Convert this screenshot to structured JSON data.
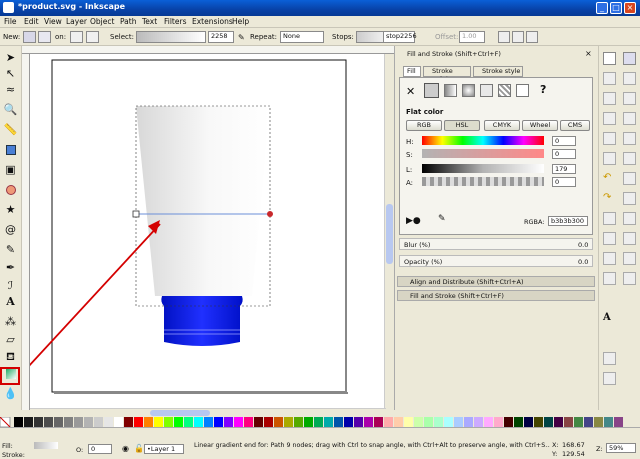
{
  "window": {
    "title": "*product.svg - Inkscape",
    "btn_min": "_",
    "btn_max": "□",
    "btn_close": "×"
  },
  "menu": [
    "File",
    "Edit",
    "View",
    "Layer",
    "Object",
    "Path",
    "Text",
    "Filters",
    "Extensions",
    "Help"
  ],
  "ctrl": {
    "new_label": "New:",
    "on_label": "on:",
    "select_label": "Select:",
    "select_value": "2258",
    "repeat_label": "Repeat:",
    "repeat_value": "None",
    "stops_label": "Stops:",
    "stops_value": "stop2256",
    "offset_label": "Offset:",
    "offset_value": "1.00"
  },
  "panel": {
    "header_title": "Fill and Stroke (Shift+Ctrl+F)",
    "tab_fill": "Fill",
    "tab_stroke_paint": "Stroke paint",
    "tab_stroke_style": "Stroke style",
    "x_glyph": "✕",
    "q_glyph": "?",
    "flat_color_label": "Flat color",
    "mode_rgb": "RGB",
    "mode_hsl": "HSL",
    "mode_cmyk": "CMYK",
    "mode_wheel": "Wheel",
    "mode_cms": "CMS",
    "h_label": "H:",
    "s_label": "S:",
    "l_label": "L:",
    "a_label": "A:",
    "h_value": "0",
    "s_value": "0",
    "l_value": "179",
    "a_value": "0",
    "rgba_label": "RGBA:",
    "rgba_value": "b3b3b300",
    "blur_label": "Blur (%)",
    "blur_value": "0.0",
    "opacity_label": "Opacity (%)",
    "opacity_value": "0.0",
    "dock1": "Align and Distribute (Shift+Ctrl+A)",
    "dock2": "Fill and Stroke (Shift+Ctrl+F)"
  },
  "status": {
    "fill_label": "Fill:",
    "stroke_label": "Stroke:",
    "o_label": "O:",
    "o_value": "0",
    "layer": "•Layer 1",
    "message": "Linear gradient end for: Path 9 nodes; drag with Ctrl to snap angle, with Ctrl+Alt to preserve angle, with Ctrl+S...",
    "x_label": "X:",
    "x_value": "168.67",
    "y_label": "Y:",
    "y_value": "129.54",
    "z_label": "Z:",
    "zoom": "59%"
  },
  "colors": {
    "accent": "#0a5fd8",
    "highlight_box": "#d40000",
    "cap_blue": "#1a1ae0"
  }
}
